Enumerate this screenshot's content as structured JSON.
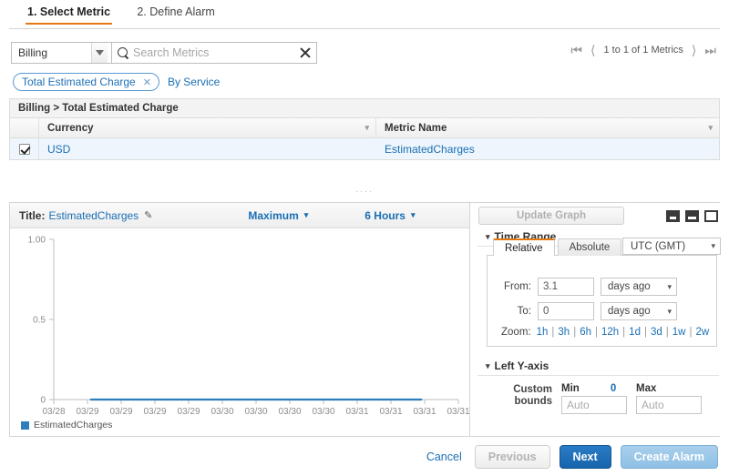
{
  "wizard": {
    "tabs": [
      {
        "label": "1. Select Metric",
        "active": true
      },
      {
        "label": "2. Define Alarm",
        "active": false
      }
    ]
  },
  "search": {
    "namespace": "Billing",
    "placeholder": "Search Metrics",
    "value": "",
    "clear_icon": "close-icon",
    "search_icon": "search-icon"
  },
  "pagination": {
    "first_icon": "first-page-icon",
    "prev_icon": "prev-page-icon",
    "label": "1 to 1 of 1 Metrics",
    "next_icon": "next-page-icon",
    "last_icon": "last-page-icon"
  },
  "dimensions": {
    "pill_label": "Total Estimated Charge",
    "pill_remove": "✕",
    "link_label": "By Service"
  },
  "table": {
    "breadcrumb": "Billing > Total Estimated Charge",
    "columns": [
      "Currency",
      "Metric Name"
    ],
    "sort_icon": "▾",
    "rows": [
      {
        "selected": true,
        "currency": "USD",
        "metric_name": "EstimatedCharges"
      }
    ]
  },
  "graph_toolbar": {
    "title_label": "Title:",
    "title_value": "EstimatedCharges",
    "edit_icon": "pencil-icon",
    "statistic": "Maximum",
    "period": "6 Hours",
    "caret": "▾"
  },
  "update": {
    "button_label": "Update Graph",
    "layout_icons": [
      "layout-bottom-icon",
      "layout-split-icon",
      "layout-full-icon"
    ]
  },
  "time_range": {
    "section_title": "Time Range",
    "triangle": "▾",
    "tabs": [
      {
        "label": "Relative",
        "active": true
      },
      {
        "label": "Absolute",
        "active": false
      }
    ],
    "timezone": "UTC (GMT)",
    "from_label": "From:",
    "from_value": "3.1",
    "from_unit": "days ago",
    "to_label": "To:",
    "to_value": "0",
    "to_unit": "days ago",
    "zoom_label": "Zoom:",
    "zoom_options": [
      "1h",
      "3h",
      "6h",
      "12h",
      "1d",
      "3d",
      "1w",
      "2w"
    ],
    "separator": "|",
    "caret": "▾"
  },
  "left_y_axis": {
    "section_title": "Left Y-axis",
    "triangle": "▾",
    "custom_bounds_label_line1": "Custom",
    "custom_bounds_label_line2": "bounds",
    "min_label": "Min",
    "min_hint": "0",
    "min_placeholder": "Auto",
    "min_value": "",
    "max_label": "Max",
    "max_placeholder": "Auto",
    "max_value": ""
  },
  "footer": {
    "cancel_label": "Cancel",
    "previous_label": "Previous",
    "next_label": "Next",
    "create_alarm_label": "Create Alarm"
  },
  "chart_data": {
    "type": "line",
    "title": "EstimatedCharges",
    "xlabel": "",
    "ylabel": "",
    "ylim": [
      0,
      1.0
    ],
    "ytick_labels": [
      "1.00",
      "0.5",
      "0"
    ],
    "ytick_values": [
      1.0,
      0.5,
      0
    ],
    "grid": false,
    "legend": [
      "EstimatedCharges"
    ],
    "legend_position": "bottom-left",
    "series_color": "#2e7ebb",
    "xtick_labels": [
      "03/28",
      "03/29",
      "03/29",
      "03/29",
      "03/29",
      "03/30",
      "03/30",
      "03/30",
      "03/30",
      "03/31",
      "03/31",
      "03/31",
      "03/31"
    ],
    "series": [
      {
        "name": "EstimatedCharges",
        "x": [
          1.1,
          2.0,
          3.0,
          4.0,
          5.0,
          6.0,
          7.0,
          8.0,
          9.0,
          10.0,
          10.9
        ],
        "values": [
          0,
          0,
          0,
          0,
          0,
          0,
          0,
          0,
          0,
          0,
          0
        ]
      }
    ]
  }
}
